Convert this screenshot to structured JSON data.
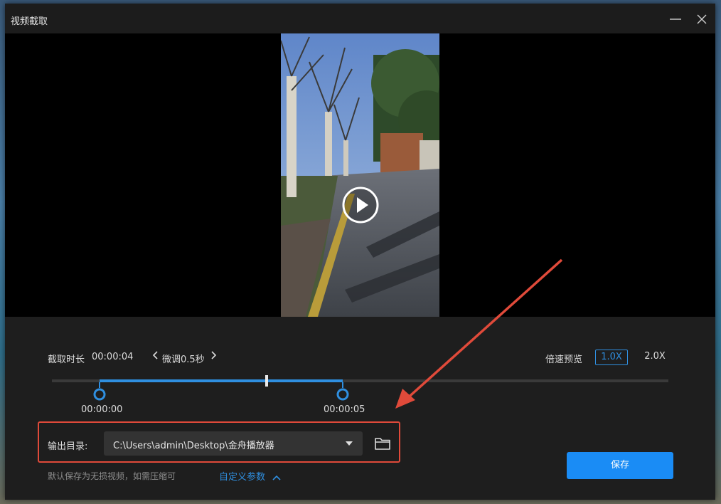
{
  "window": {
    "title": "视频截取"
  },
  "trim": {
    "duration_label": "截取时长",
    "duration_value": "00:00:04",
    "fine_tune_label": "微调0.5秒",
    "speed_label": "倍速预览",
    "speeds": [
      "1.0X",
      "2.0X"
    ],
    "active_speed": "1.0X",
    "start_time": "00:00:00",
    "end_time": "00:00:05"
  },
  "output": {
    "label": "输出目录:",
    "path": "C:\\Users\\admin\\Desktop\\金舟播放器",
    "note": "默认保存为无损视频，如需压缩可",
    "custom_params": "自定义参数"
  },
  "actions": {
    "save": "保存"
  },
  "colors": {
    "accent": "#2f8fe0",
    "highlight": "#e04a3a",
    "save_bg": "#1a8cf5"
  },
  "icons": [
    "minimize-icon",
    "close-icon",
    "play-icon",
    "chevron-left-icon",
    "chevron-right-icon",
    "dropdown-caret-icon",
    "folder-icon",
    "chevron-up-icon"
  ]
}
